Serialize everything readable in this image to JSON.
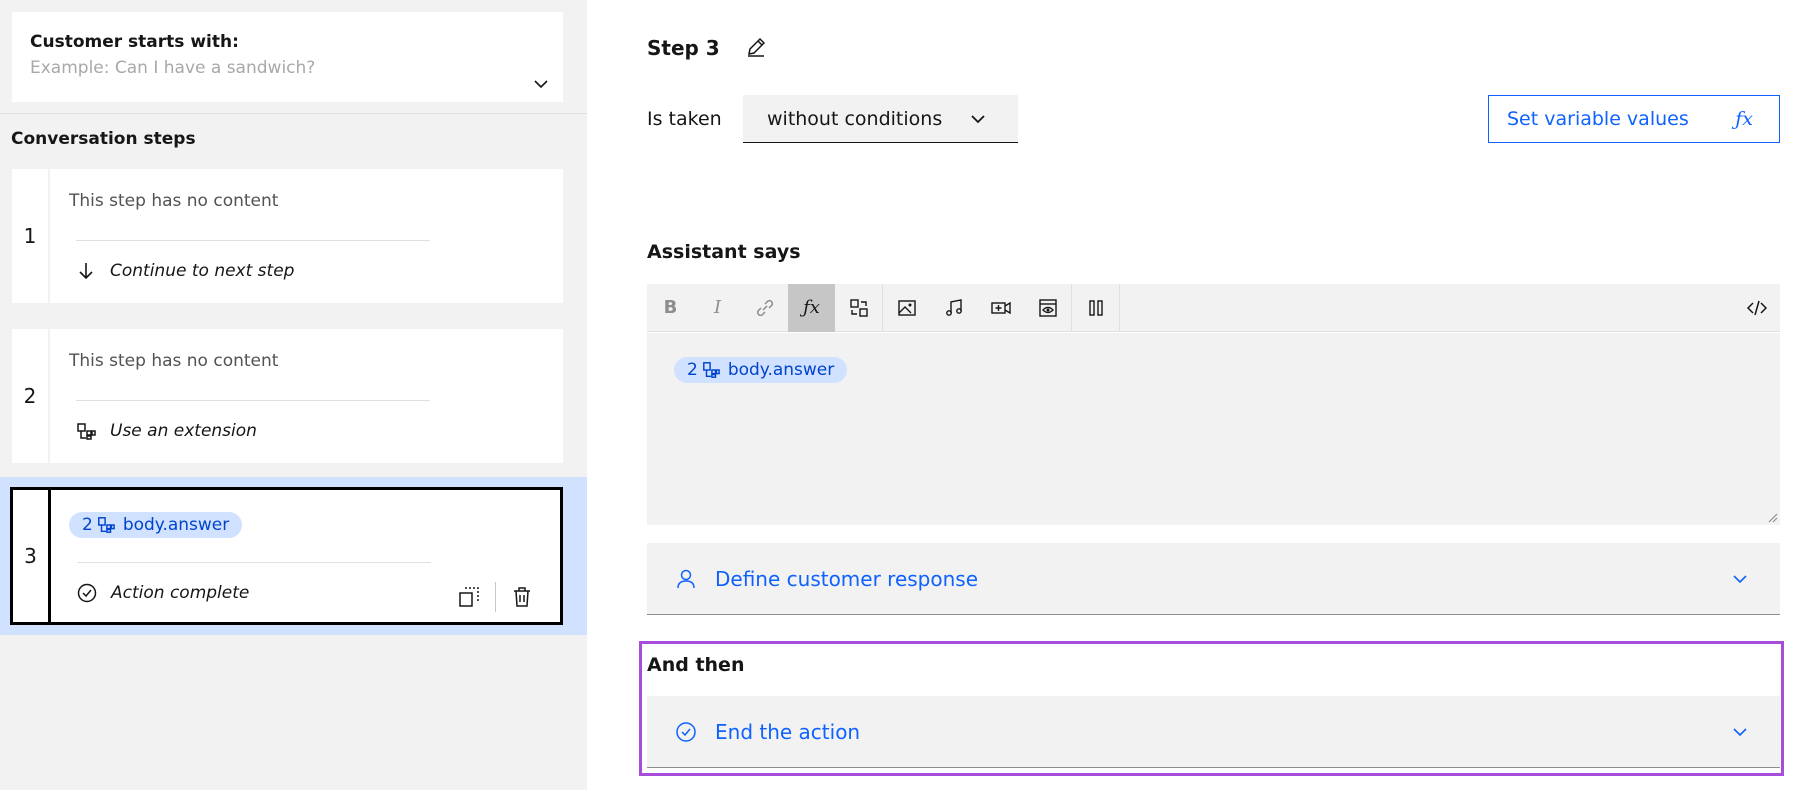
{
  "customer_starts": {
    "label": "Customer starts with:",
    "placeholder": "Example: Can I have a sandwich?"
  },
  "conversation_steps": {
    "title": "Conversation steps",
    "steps": [
      {
        "number": "1",
        "content": "This step has no content",
        "next": "Continue to next step",
        "next_icon": "arrow-down-icon"
      },
      {
        "number": "2",
        "content": "This step has no content",
        "next": "Use an extension",
        "next_icon": "extension-icon"
      },
      {
        "number": "3",
        "tag_count": "2",
        "tag_label": "body.answer",
        "next": "Action complete",
        "next_icon": "checkmark-circle-icon"
      }
    ]
  },
  "editor": {
    "step_title": "Step 3",
    "is_taken_label": "Is taken",
    "condition_value": "without conditions",
    "set_variable_button": "Set variable values",
    "fx_label": "ƒx",
    "assistant_says_title": "Assistant says",
    "toolbar": [
      "bold",
      "italic",
      "link",
      "function",
      "variable-swap",
      "image",
      "audio",
      "video",
      "iframe",
      "pause",
      "code-view"
    ],
    "response_tag_count": "2",
    "response_tag_label": "body.answer",
    "customer_response": "Define customer response",
    "and_then_title": "And then",
    "and_then_value": "End the action"
  },
  "colors": {
    "accent": "#0f62fe",
    "selection": "#d0e2ff",
    "highlight_border": "#a64ddb"
  }
}
